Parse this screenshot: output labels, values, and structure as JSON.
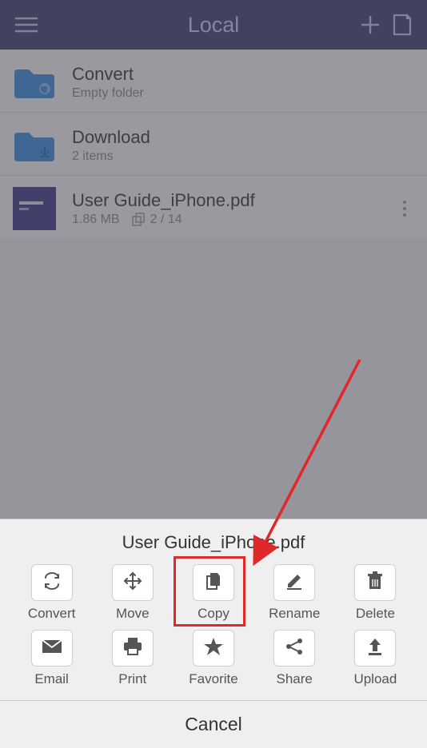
{
  "header": {
    "title": "Local"
  },
  "files": [
    {
      "name": "Convert",
      "meta1": "Empty folder",
      "meta2": "",
      "type": "folder-sync"
    },
    {
      "name": "Download",
      "meta1": "2 items",
      "meta2": "",
      "type": "folder-down"
    },
    {
      "name": "User Guide_iPhone.pdf",
      "meta1": "1.86 MB",
      "meta2": "2 / 14",
      "type": "pdf"
    }
  ],
  "sheet": {
    "title": "User Guide_iPhone.pdf",
    "actions": [
      {
        "label": "Convert"
      },
      {
        "label": "Move"
      },
      {
        "label": "Copy"
      },
      {
        "label": "Rename"
      },
      {
        "label": "Delete"
      },
      {
        "label": "Email"
      },
      {
        "label": "Print"
      },
      {
        "label": "Favorite"
      },
      {
        "label": "Share"
      },
      {
        "label": "Upload"
      }
    ],
    "cancel": "Cancel"
  }
}
